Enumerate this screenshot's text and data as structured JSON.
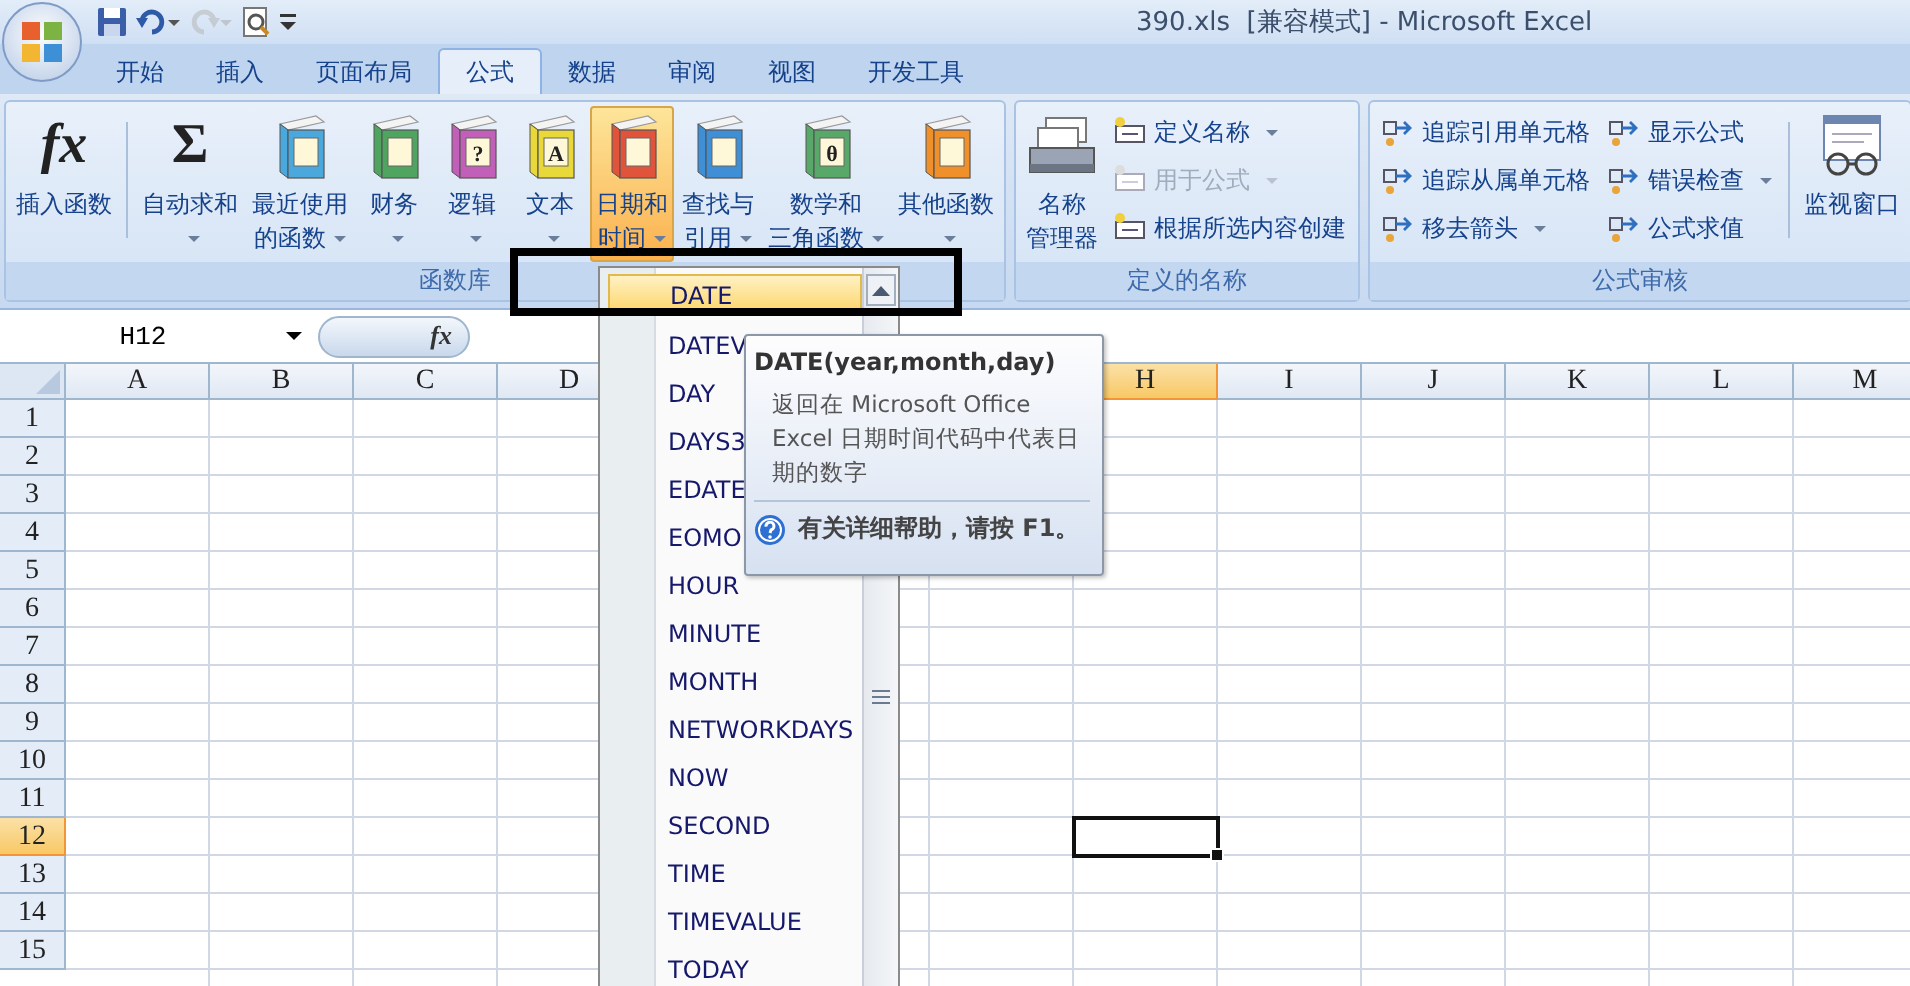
{
  "window": {
    "title": "390.xls  [兼容模式] - Microsoft Excel"
  },
  "quick_access": [
    {
      "kind": "save",
      "disabled": false
    },
    {
      "kind": "undo",
      "dropdown": true,
      "disabled": false
    },
    {
      "kind": "redo",
      "dropdown": true,
      "disabled": true
    },
    {
      "kind": "preview",
      "disabled": false
    },
    {
      "kind": "customize"
    }
  ],
  "tabs": [
    {
      "label": "开始",
      "selected": false
    },
    {
      "label": "插入",
      "selected": false
    },
    {
      "label": "页面布局",
      "selected": false
    },
    {
      "label": "公式",
      "selected": true
    },
    {
      "label": "数据",
      "selected": false
    },
    {
      "label": "审阅",
      "selected": false
    },
    {
      "label": "视图",
      "selected": false
    },
    {
      "label": "开发工具",
      "selected": false
    }
  ],
  "ribbon": {
    "groups": [
      {
        "kind": "library",
        "label": "函数库",
        "buttons": [
          {
            "kind": "plain",
            "glyph": "fx",
            "lines": [
              "插入函数"
            ],
            "dropdown": false,
            "active": false
          },
          {
            "kind": "plain",
            "glyph": "Σ",
            "lines": [
              "自动求和"
            ],
            "dropdown": true,
            "active": false
          },
          {
            "kind": "book",
            "color": "#4aa8dc",
            "lines": [
              "最近使用",
              "的函数"
            ],
            "dropdown": true,
            "active": false
          },
          {
            "kind": "book",
            "color": "#4fa560",
            "lines": [
              "财务"
            ],
            "dropdown": true,
            "active": false
          },
          {
            "kind": "book",
            "color": "#c25fb8",
            "glyph": "?",
            "lines": [
              "逻辑"
            ],
            "dropdown": true,
            "active": false
          },
          {
            "kind": "book",
            "color": "#e8d83a",
            "glyph": "A",
            "lines": [
              "文本"
            ],
            "dropdown": true,
            "active": false
          },
          {
            "kind": "book",
            "color": "#e0543c",
            "lines": [
              "日期和",
              "时间"
            ],
            "dropdown": true,
            "active": true
          },
          {
            "kind": "book",
            "color": "#3f8fd6",
            "lines": [
              "查找与",
              "引用"
            ],
            "dropdown": true,
            "active": false
          },
          {
            "kind": "book",
            "color": "#58a86a",
            "glyph": "θ",
            "lines": [
              "数学和",
              "三角函数"
            ],
            "dropdown": true,
            "active": false
          },
          {
            "kind": "book",
            "color": "#f0902a",
            "lines": [
              "其他函数"
            ],
            "dropdown": true,
            "active": false
          }
        ]
      },
      {
        "kind": "names",
        "label": "定义的名称",
        "buttons": [
          {
            "kind": "names",
            "lines": [
              "名称",
              "管理器"
            ],
            "dropdown": false,
            "active": false
          }
        ],
        "small_columns": [
          [
            {
              "label": "定义名称",
              "dropdown": true,
              "disabled": false
            },
            {
              "label": "用于公式",
              "dropdown": true,
              "disabled": true
            },
            {
              "label": "根据所选内容创建",
              "dropdown": false,
              "disabled": false
            }
          ]
        ]
      },
      {
        "kind": "audit",
        "label": "公式审核",
        "buttons": [
          {
            "kind": "watch",
            "lines": [
              "监视窗口"
            ],
            "dropdown": false,
            "active": false
          }
        ],
        "small_columns": [
          [
            {
              "label": "追踪引用单元格",
              "dropdown": false,
              "disabled": false
            },
            {
              "label": "追踪从属单元格",
              "dropdown": false,
              "disabled": false
            },
            {
              "label": "移去箭头",
              "dropdown": true,
              "disabled": false
            }
          ],
          [
            {
              "label": "显示公式",
              "dropdown": false,
              "disabled": false
            },
            {
              "label": "错误检查",
              "dropdown": true,
              "disabled": false
            },
            {
              "label": "公式求值",
              "dropdown": false,
              "disabled": false
            }
          ]
        ]
      }
    ]
  },
  "formula_bar": {
    "name_box": "H12",
    "fx_glyph": "fx"
  },
  "grid": {
    "columns": [
      {
        "label": "A",
        "selected": false
      },
      {
        "label": "B",
        "selected": false
      },
      {
        "label": "C",
        "selected": false
      },
      {
        "label": "D",
        "selected": false
      },
      {},
      {},
      {},
      {
        "label": "H",
        "selected": true
      },
      {
        "label": "I",
        "selected": false
      },
      {
        "label": "J",
        "selected": false
      },
      {
        "label": "K",
        "selected": false
      },
      {
        "label": "L",
        "selected": false
      },
      {
        "label": "M",
        "selected": false
      }
    ],
    "rows": [
      {
        "label": "1",
        "selected": false
      },
      {
        "label": "2",
        "selected": false
      },
      {
        "label": "3",
        "selected": false
      },
      {
        "label": "4",
        "selected": false
      },
      {
        "label": "5",
        "selected": false
      },
      {
        "label": "6",
        "selected": false
      },
      {
        "label": "7",
        "selected": false
      },
      {
        "label": "8",
        "selected": false
      },
      {
        "label": "9",
        "selected": false
      },
      {
        "label": "10",
        "selected": false
      },
      {
        "label": "11",
        "selected": false
      },
      {
        "label": "12",
        "selected": true
      },
      {
        "label": "13",
        "selected": false
      },
      {
        "label": "14",
        "selected": false
      },
      {
        "label": "15",
        "selected": false
      }
    ]
  },
  "function_menu": {
    "items": [
      {
        "label": "DATE",
        "selected": true
      },
      {
        "label": "DATEV",
        "selected": false
      },
      {
        "label": "DAY",
        "selected": false
      },
      {
        "label": "DAYS3",
        "selected": false
      },
      {
        "label": "EDATE",
        "selected": false
      },
      {
        "label": "EOMO",
        "selected": false
      },
      {
        "label": "HOUR",
        "selected": false
      },
      {
        "label": "MINUTE",
        "selected": false
      },
      {
        "label": "MONTH",
        "selected": false
      },
      {
        "label": "NETWORKDAYS",
        "selected": false
      },
      {
        "label": "NOW",
        "selected": false
      },
      {
        "label": "SECOND",
        "selected": false
      },
      {
        "label": "TIME",
        "selected": false
      },
      {
        "label": "TIMEVALUE",
        "selected": false
      },
      {
        "label": "TODAY",
        "selected": false
      }
    ]
  },
  "tooltip": {
    "signature": "DATE(year,month,day)",
    "description": "返回在 Microsoft Office Excel 日期时间代码中代表日期的数字",
    "help": "有关详细帮助，请按 F1。"
  }
}
